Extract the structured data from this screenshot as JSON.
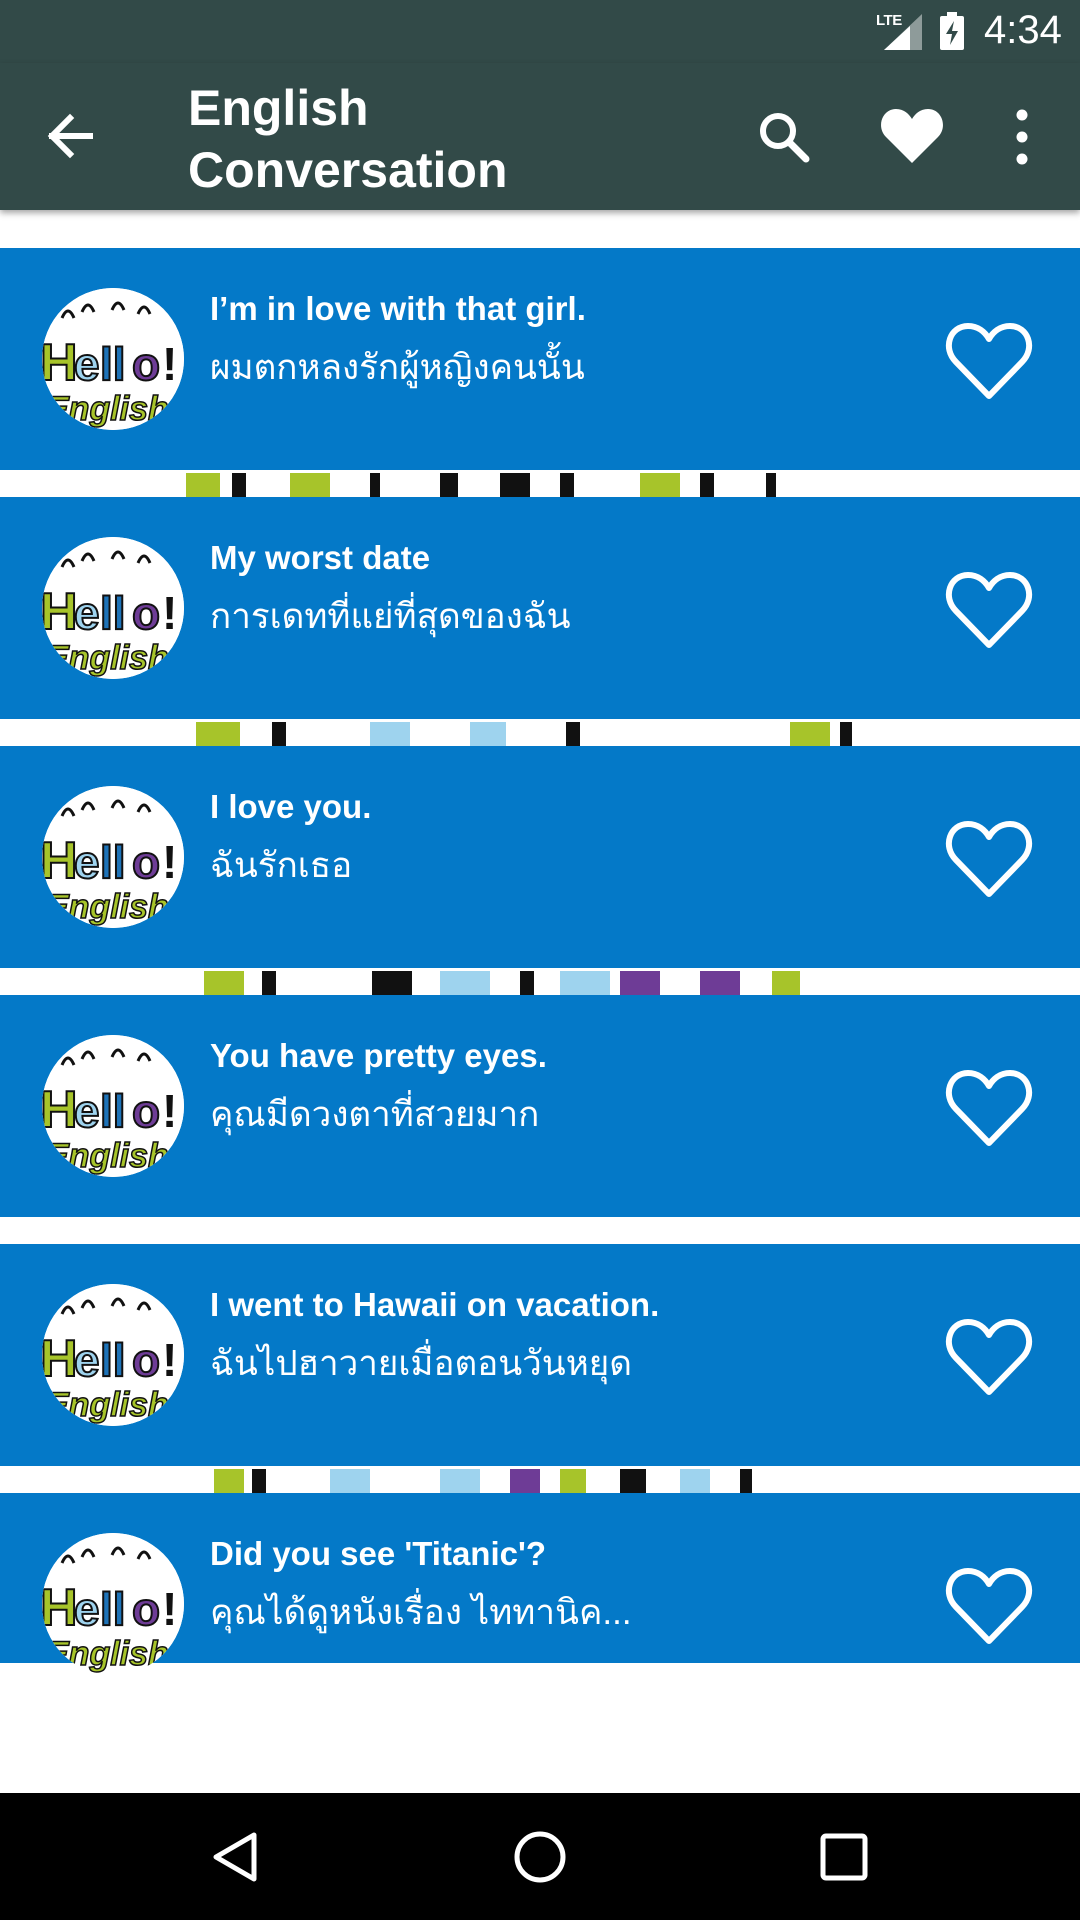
{
  "status_bar": {
    "network": "LTE",
    "time": "4:34"
  },
  "app_bar": {
    "title": "English Conversation",
    "icons": [
      "back-arrow-icon",
      "search-icon",
      "heart-icon",
      "more-vert-icon"
    ]
  },
  "colors": {
    "toolbar": "#324A48",
    "card": "#0479C8",
    "nav_bar": "#000000"
  },
  "phrases": [
    {
      "english": "I’m in love with that girl.",
      "thai": "ผมตกหลงรักผู้หญิงคนนั้น",
      "favorite_icon": "heart-outline-icon"
    },
    {
      "english": "My worst date",
      "thai": "การเดทที่แย่ที่สุดของฉัน",
      "favorite_icon": "heart-outline-icon"
    },
    {
      "english": "I love you.",
      "thai": "ฉันรักเธอ",
      "favorite_icon": "heart-outline-icon"
    },
    {
      "english": "You have pretty eyes.",
      "thai": "คุณมีดวงตาที่สวยมาก",
      "favorite_icon": "heart-outline-icon"
    },
    {
      "english": "I went to Hawaii on vacation.",
      "thai": "ฉันไปฮาวายเมื่อตอนวันหยุด",
      "favorite_icon": "heart-outline-icon"
    },
    {
      "english": "Did you see 'Titanic'?",
      "thai": "คุณได้ดูหนังเรื่อง ไททานิค...",
      "favorite_icon": "heart-outline-icon"
    }
  ],
  "nav_bar": {
    "icons": [
      "nav-back-icon",
      "nav-home-icon",
      "nav-recents-icon"
    ]
  }
}
